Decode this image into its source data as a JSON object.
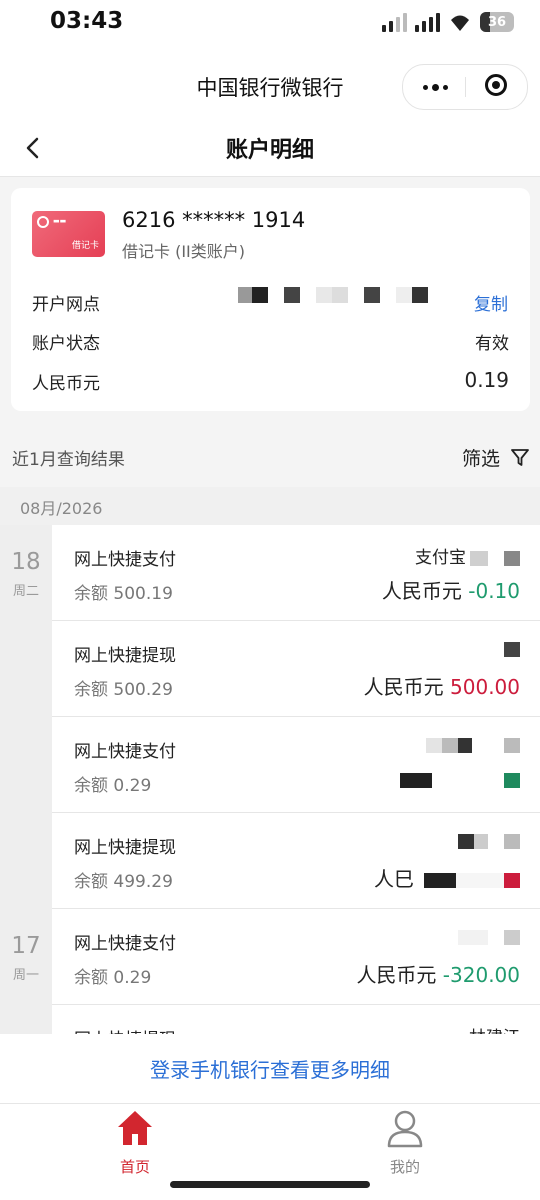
{
  "status_bar": {
    "time": "03:43",
    "battery": "36"
  },
  "app": {
    "title": "中国银行微银行"
  },
  "nav": {
    "title": "账户明细"
  },
  "account": {
    "card_badge": "借记卡",
    "card_number": "6216 ****** 1914",
    "card_type": "借记卡 (II类账户)",
    "rows": [
      {
        "label": "开户网点",
        "action": "复制"
      },
      {
        "label": "账户状态",
        "value": "有效"
      },
      {
        "label": "人民币元",
        "value": "0.19"
      }
    ]
  },
  "query": {
    "label": "近1月查询结果",
    "filter_label": "筛选"
  },
  "month": "08月/2026",
  "days": [
    {
      "day": "18",
      "weekday": "周二"
    },
    {
      "day": "17",
      "weekday": "周一"
    }
  ],
  "transactions": [
    {
      "name": "网上快捷支付",
      "balance": "余额 500.19",
      "counterparty": "支付宝",
      "currency": "人民币元",
      "amount": "-0.10"
    },
    {
      "name": "网上快捷提现",
      "balance": "余额 500.29",
      "counterparty": "",
      "currency": "人民币元",
      "amount": "500.00"
    },
    {
      "name": "网上快捷支付",
      "balance": "余额 0.29",
      "counterparty": "",
      "currency": "",
      "amount": ""
    },
    {
      "name": "网上快捷提现",
      "balance": "余额 499.29",
      "counterparty": "",
      "currency": "人巳",
      "amount": ""
    },
    {
      "name": "网上快捷支付",
      "balance": "余额 0.29",
      "counterparty": "",
      "currency": "人民币元",
      "amount": "-320.00"
    },
    {
      "name": "网上快捷提现",
      "balance": "",
      "counterparty": "林建江",
      "currency": "",
      "amount": ""
    }
  ],
  "login_link": "登录手机银行查看更多明细",
  "tabs": [
    {
      "label": "首页",
      "icon": "home-icon",
      "active": true,
      "color": "#d2262f"
    },
    {
      "label": "我的",
      "icon": "user-icon",
      "active": false,
      "color": "#888888"
    }
  ]
}
